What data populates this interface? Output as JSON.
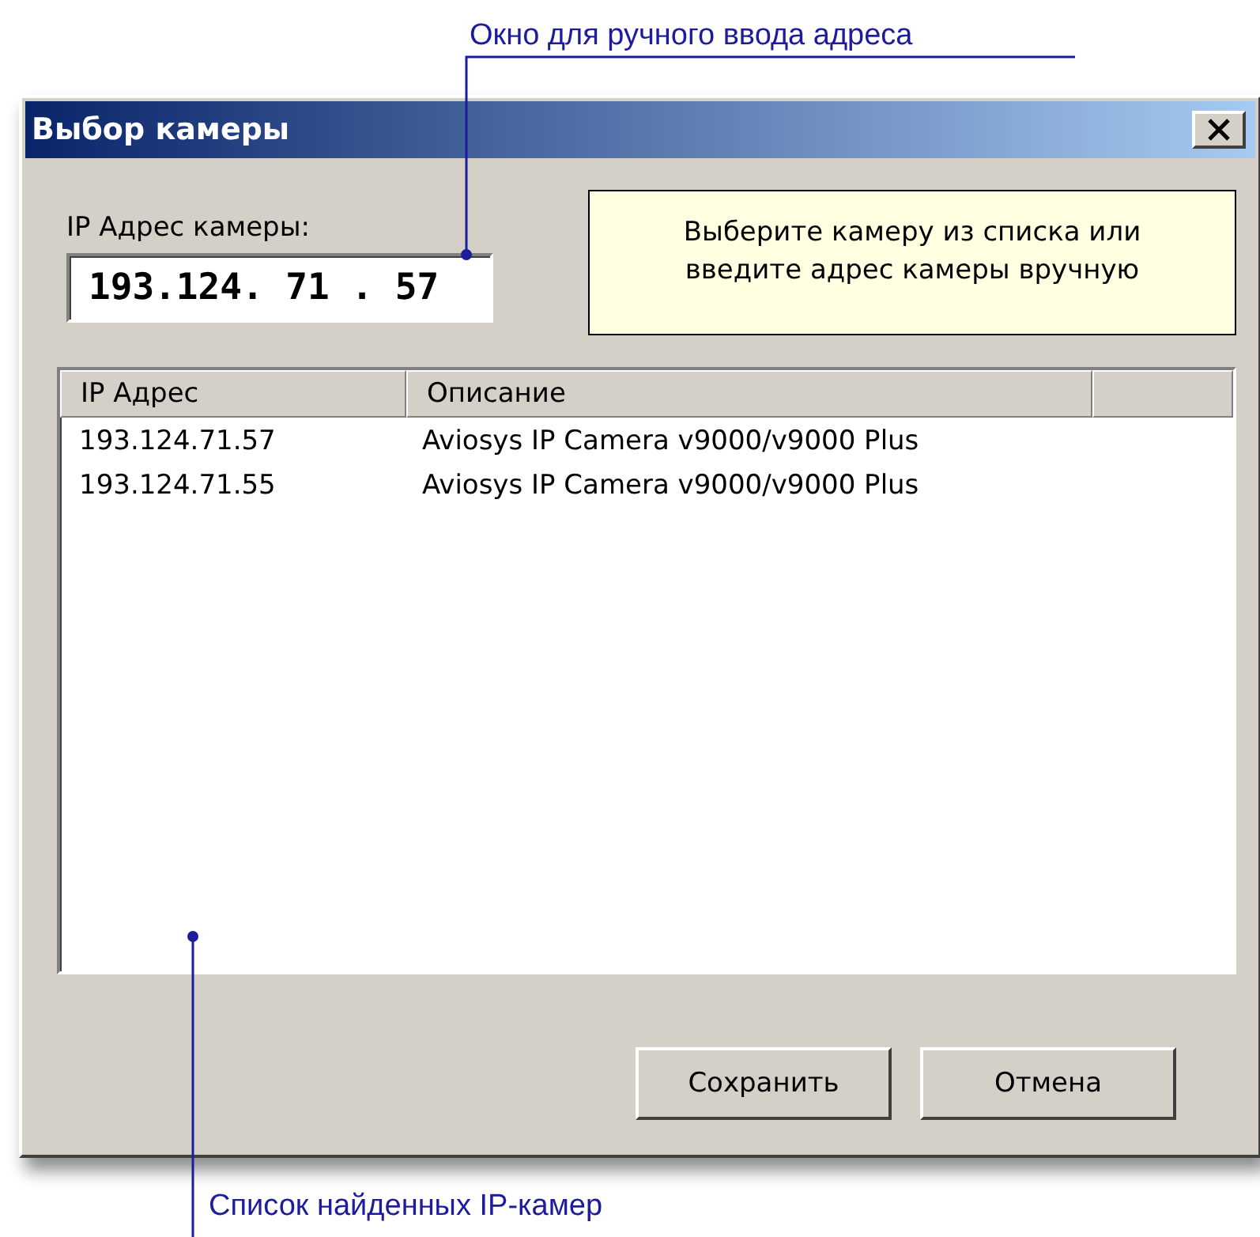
{
  "annotations": [
    {
      "text": "Окно для ручного ввода адреса"
    },
    {
      "text": "Список найденных IP-камер"
    }
  ],
  "window": {
    "title": "Выбор камеры"
  },
  "address": {
    "label": "IP Адрес камеры:",
    "value": "193.124. 71 . 57"
  },
  "hint": "Выберите камеру из списка или\nвведите адрес камеры вручную",
  "table": {
    "columns": [
      "IP Адрес",
      "Описание"
    ],
    "rows": [
      [
        "193.124.71.57",
        "Aviosys IP Camera v9000/v9000 Plus"
      ],
      [
        "193.124.71.55",
        "Aviosys IP Camera v9000/v9000 Plus"
      ]
    ]
  },
  "buttons": [
    "Сохранить",
    "Отмена"
  ]
}
